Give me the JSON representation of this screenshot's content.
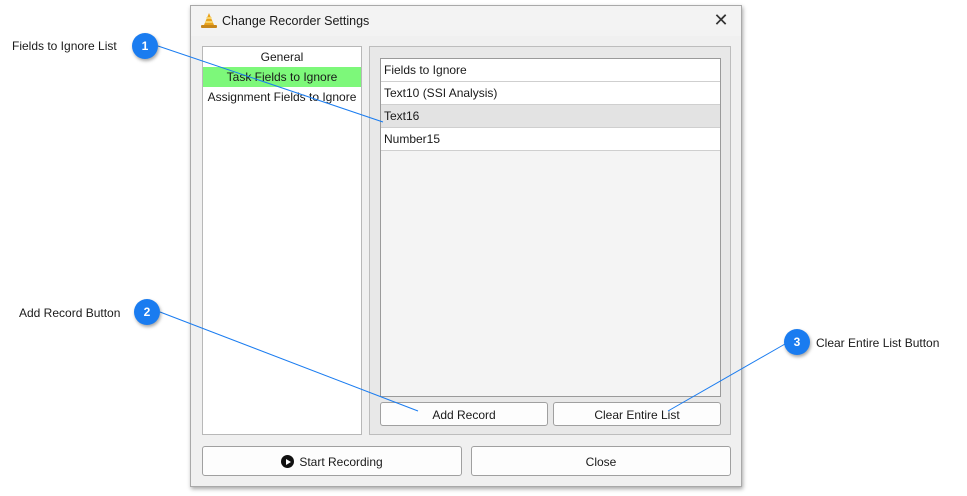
{
  "dialog": {
    "title": "Change Recorder Settings",
    "close_glyph": "✕",
    "icon": "traffic-cone-icon"
  },
  "nav": {
    "items": [
      {
        "label": "General",
        "active": false
      },
      {
        "label": "Task Fields to Ignore",
        "active": true
      },
      {
        "label": "Assignment Fields to Ignore",
        "active": false
      }
    ]
  },
  "list": {
    "header": "Fields to Ignore",
    "rows": [
      "Text10 (SSI Analysis)",
      "Text16",
      "Number15"
    ],
    "selected_row": "Text16"
  },
  "buttons": {
    "add_record": "Add Record",
    "clear_list": "Clear Entire List",
    "start_recording": "Start Recording",
    "close": "Close"
  },
  "callouts": [
    {
      "number": "1",
      "label": "Fields to Ignore List"
    },
    {
      "number": "2",
      "label": "Add Record Button"
    },
    {
      "number": "3",
      "label": "Clear Entire List Button"
    }
  ],
  "colors": {
    "accent_active": "#7df87a",
    "callout_badge": "#1a7cf0",
    "leader_line": "#1a7cf0"
  }
}
